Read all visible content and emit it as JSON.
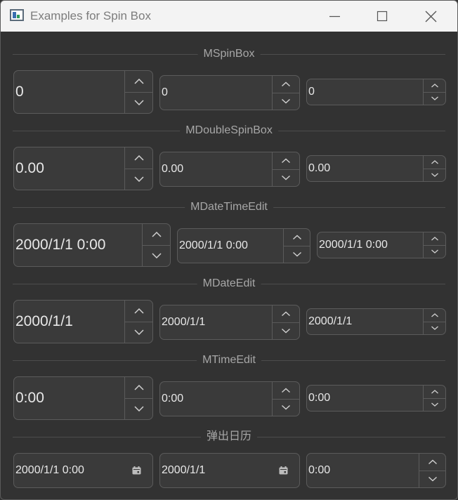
{
  "window": {
    "title": "Examples for Spin Box"
  },
  "sections": [
    {
      "title": "MSpinBox",
      "values": [
        "0",
        "0",
        "0"
      ]
    },
    {
      "title": "MDoubleSpinBox",
      "values": [
        "0.00",
        "0.00",
        "0.00"
      ]
    },
    {
      "title": "MDateTimeEdit",
      "values": [
        "2000/1/1 0:00",
        "2000/1/1 0:00",
        "2000/1/1 0:00"
      ]
    },
    {
      "title": "MDateEdit",
      "values": [
        "2000/1/1",
        "2000/1/1",
        "2000/1/1"
      ]
    },
    {
      "title": "MTimeEdit",
      "values": [
        "0:00",
        "0:00",
        "0:00"
      ]
    },
    {
      "title": "弹出日历",
      "values": [
        "2000/1/1 0:00",
        "2000/1/1",
        "0:00"
      ]
    }
  ],
  "icons": {
    "app": "app-window-icon",
    "minimize": "minimize-icon",
    "maximize": "maximize-icon",
    "close": "close-icon",
    "up": "chevron-up-icon",
    "down": "chevron-down-icon",
    "calendar": "calendar-icon"
  },
  "colors": {
    "background": "#323232",
    "field": "#3a3a3a",
    "border": "#5b5b5b",
    "text": "#e8e8e8",
    "header_text": "#a7a7a7"
  }
}
